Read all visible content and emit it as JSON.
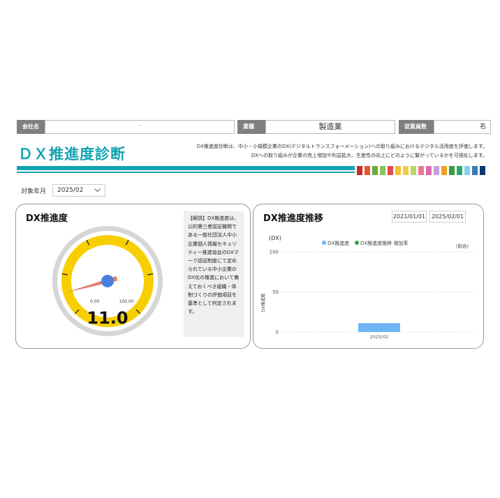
{
  "header": {
    "company_label": "会社名",
    "company_value": "・",
    "industry_label": "業種",
    "industry_value": "製造業",
    "employees_label": "従業員数",
    "employees_unit": "名"
  },
  "title": "ＤＸ推進度診断",
  "description": {
    "line1": "DX推進度診断は、中小・小規模企業のDX(デジタルトランスフォーメーション)への取り組みにおけるデジタル活用度を評価します。",
    "line2": "DXへの取り組みが企業の売上増加や利益拡大、生産性の向上にどのように繋がっているかを可視化します。"
  },
  "colors": {
    "accent": "#13a3b2",
    "gauge_yellow": "#f7cf00",
    "needle": "#e08070",
    "hub": "#4a7fe0",
    "bar": "#6fb4f5",
    "legend_green": "#2aa84a",
    "swatches": [
      "#cc2b2b",
      "#e8562a",
      "#6aaa3c",
      "#8fc25a",
      "#e34b4b",
      "#f2c230",
      "#f5c94a",
      "#b9d56a",
      "#e87b8e",
      "#dc6ab0",
      "#c7a0d6",
      "#f0a020",
      "#3e9a3e",
      "#2aa86a",
      "#8ad0e8",
      "#3a7ac0",
      "#0e3a70"
    ]
  },
  "filter": {
    "label": "対象年月",
    "value": "2025/02"
  },
  "dx_card": {
    "title": "DX推進度",
    "gauge_min": "0.00",
    "gauge_max": "100.00",
    "value": "11.0",
    "value_num": 11.0,
    "note": "【解説】DX推進度は、公的第三者認証機関である一般社団法人中小企業個人情報セキュリティー推進協会のDXマーク認証制度にて定められている中小企業のDX化の推進において備えておくべき組織・体制づくりの評価項目を基準として判定されます。"
  },
  "trend_card": {
    "title": "DX推進度推移",
    "date_from": "2021/01/01",
    "date_to": "2025/02/01",
    "y_unit_left": "(DX)",
    "y_unit_right": "(割合)",
    "legend": [
      {
        "name": "DX推進度",
        "color": "#6fb4f5"
      },
      {
        "name": "DX推進度推移 増加率",
        "color": "#2aa84a"
      }
    ]
  },
  "chart_data": {
    "type": "bar",
    "categories": [
      "2025/02"
    ],
    "series": [
      {
        "name": "DX推進度",
        "values": [
          11.0
        ]
      }
    ],
    "ylabel": "DX推進度",
    "yticks": [
      0,
      50,
      100
    ],
    "ylim": [
      0,
      100
    ],
    "legend_position": "top"
  }
}
